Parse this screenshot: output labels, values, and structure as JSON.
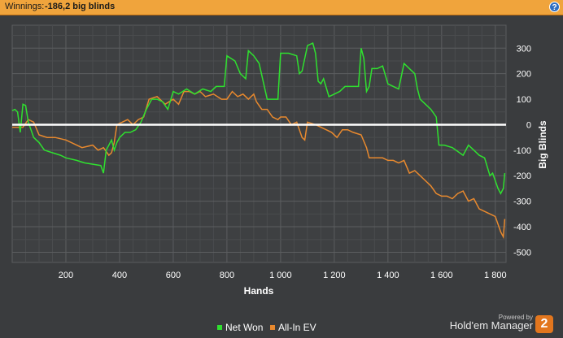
{
  "header": {
    "label": "Winnings:",
    "value": "-186,2 big blinds",
    "help_icon": "?"
  },
  "colors": {
    "net_won": "#2fe02f",
    "all_in_ev": "#e8892e",
    "zero_line": "#ffffff",
    "header_bg": "#f0a43c"
  },
  "chart_data": {
    "type": "line",
    "xlabel": "Hands",
    "ylabel": "Big Blinds",
    "xlim": [
      0,
      1840
    ],
    "ylim": [
      -540,
      390
    ],
    "x_ticks": [
      200,
      400,
      600,
      800,
      1000,
      1200,
      1400,
      1600,
      1800
    ],
    "x_tick_labels": [
      "200",
      "400",
      "600",
      "800",
      "1 000",
      "1 200",
      "1 400",
      "1 600",
      "1 800"
    ],
    "y_ticks": [
      300,
      200,
      100,
      0,
      -100,
      -200,
      -300,
      -400,
      -500
    ],
    "y_tick_labels": [
      "300",
      "200",
      "100",
      "0",
      "-100",
      "-200",
      "-300",
      "-400",
      "-500"
    ],
    "grid": true,
    "legend": "bottom-center",
    "series": [
      {
        "name": "Net Won",
        "points": [
          [
            0,
            55
          ],
          [
            10,
            60
          ],
          [
            20,
            50
          ],
          [
            30,
            -30
          ],
          [
            40,
            80
          ],
          [
            50,
            75
          ],
          [
            60,
            10
          ],
          [
            80,
            -50
          ],
          [
            100,
            -70
          ],
          [
            120,
            -100
          ],
          [
            150,
            -110
          ],
          [
            180,
            -120
          ],
          [
            200,
            -130
          ],
          [
            240,
            -140
          ],
          [
            270,
            -150
          ],
          [
            300,
            -155
          ],
          [
            330,
            -160
          ],
          [
            340,
            -190
          ],
          [
            350,
            -100
          ],
          [
            360,
            -80
          ],
          [
            370,
            -60
          ],
          [
            380,
            -100
          ],
          [
            390,
            -70
          ],
          [
            400,
            -50
          ],
          [
            420,
            -30
          ],
          [
            440,
            -30
          ],
          [
            460,
            -20
          ],
          [
            480,
            10
          ],
          [
            500,
            60
          ],
          [
            520,
            100
          ],
          [
            540,
            100
          ],
          [
            560,
            90
          ],
          [
            580,
            60
          ],
          [
            600,
            130
          ],
          [
            620,
            120
          ],
          [
            650,
            140
          ],
          [
            680,
            120
          ],
          [
            710,
            140
          ],
          [
            740,
            130
          ],
          [
            760,
            150
          ],
          [
            790,
            150
          ],
          [
            800,
            270
          ],
          [
            830,
            250
          ],
          [
            850,
            200
          ],
          [
            870,
            180
          ],
          [
            880,
            290
          ],
          [
            900,
            270
          ],
          [
            920,
            240
          ],
          [
            950,
            100
          ],
          [
            990,
            100
          ],
          [
            1000,
            280
          ],
          [
            1030,
            280
          ],
          [
            1060,
            270
          ],
          [
            1070,
            200
          ],
          [
            1080,
            210
          ],
          [
            1100,
            310
          ],
          [
            1120,
            320
          ],
          [
            1130,
            280
          ],
          [
            1140,
            170
          ],
          [
            1150,
            160
          ],
          [
            1160,
            180
          ],
          [
            1180,
            110
          ],
          [
            1200,
            120
          ],
          [
            1220,
            130
          ],
          [
            1240,
            150
          ],
          [
            1270,
            150
          ],
          [
            1290,
            150
          ],
          [
            1300,
            300
          ],
          [
            1310,
            260
          ],
          [
            1320,
            130
          ],
          [
            1330,
            150
          ],
          [
            1340,
            220
          ],
          [
            1360,
            220
          ],
          [
            1380,
            230
          ],
          [
            1400,
            160
          ],
          [
            1420,
            150
          ],
          [
            1440,
            140
          ],
          [
            1460,
            240
          ],
          [
            1480,
            220
          ],
          [
            1500,
            200
          ],
          [
            1510,
            140
          ],
          [
            1520,
            100
          ],
          [
            1540,
            80
          ],
          [
            1560,
            60
          ],
          [
            1580,
            30
          ],
          [
            1590,
            -80
          ],
          [
            1610,
            -80
          ],
          [
            1640,
            -90
          ],
          [
            1680,
            -120
          ],
          [
            1700,
            -80
          ],
          [
            1720,
            -100
          ],
          [
            1740,
            -120
          ],
          [
            1760,
            -130
          ],
          [
            1780,
            -200
          ],
          [
            1790,
            -190
          ],
          [
            1800,
            -220
          ],
          [
            1810,
            -250
          ],
          [
            1820,
            -270
          ],
          [
            1830,
            -250
          ],
          [
            1835,
            -190
          ]
        ]
      },
      {
        "name": "All-In EV",
        "points": [
          [
            0,
            -10
          ],
          [
            40,
            -10
          ],
          [
            60,
            20
          ],
          [
            80,
            10
          ],
          [
            100,
            -40
          ],
          [
            130,
            -50
          ],
          [
            160,
            -50
          ],
          [
            200,
            -60
          ],
          [
            240,
            -80
          ],
          [
            260,
            -90
          ],
          [
            300,
            -80
          ],
          [
            320,
            -100
          ],
          [
            340,
            -90
          ],
          [
            360,
            -120
          ],
          [
            370,
            -110
          ],
          [
            380,
            -70
          ],
          [
            390,
            0
          ],
          [
            410,
            10
          ],
          [
            430,
            20
          ],
          [
            450,
            0
          ],
          [
            470,
            20
          ],
          [
            490,
            30
          ],
          [
            510,
            100
          ],
          [
            540,
            110
          ],
          [
            570,
            80
          ],
          [
            600,
            100
          ],
          [
            620,
            80
          ],
          [
            640,
            130
          ],
          [
            660,
            130
          ],
          [
            680,
            120
          ],
          [
            700,
            130
          ],
          [
            720,
            110
          ],
          [
            750,
            120
          ],
          [
            780,
            100
          ],
          [
            800,
            100
          ],
          [
            820,
            130
          ],
          [
            840,
            110
          ],
          [
            860,
            120
          ],
          [
            880,
            100
          ],
          [
            900,
            120
          ],
          [
            910,
            90
          ],
          [
            930,
            60
          ],
          [
            950,
            60
          ],
          [
            970,
            30
          ],
          [
            990,
            20
          ],
          [
            1000,
            30
          ],
          [
            1020,
            30
          ],
          [
            1040,
            0
          ],
          [
            1060,
            10
          ],
          [
            1080,
            -50
          ],
          [
            1090,
            -60
          ],
          [
            1100,
            10
          ],
          [
            1130,
            0
          ],
          [
            1150,
            -10
          ],
          [
            1170,
            -20
          ],
          [
            1190,
            -30
          ],
          [
            1210,
            -50
          ],
          [
            1230,
            -20
          ],
          [
            1250,
            -20
          ],
          [
            1270,
            -30
          ],
          [
            1300,
            -40
          ],
          [
            1320,
            -90
          ],
          [
            1330,
            -130
          ],
          [
            1350,
            -130
          ],
          [
            1380,
            -130
          ],
          [
            1400,
            -140
          ],
          [
            1420,
            -140
          ],
          [
            1440,
            -150
          ],
          [
            1460,
            -140
          ],
          [
            1480,
            -190
          ],
          [
            1500,
            -180
          ],
          [
            1520,
            -200
          ],
          [
            1540,
            -220
          ],
          [
            1560,
            -240
          ],
          [
            1580,
            -270
          ],
          [
            1600,
            -280
          ],
          [
            1620,
            -280
          ],
          [
            1640,
            -290
          ],
          [
            1660,
            -270
          ],
          [
            1680,
            -260
          ],
          [
            1700,
            -300
          ],
          [
            1720,
            -290
          ],
          [
            1740,
            -330
          ],
          [
            1760,
            -340
          ],
          [
            1780,
            -350
          ],
          [
            1800,
            -360
          ],
          [
            1810,
            -390
          ],
          [
            1820,
            -420
          ],
          [
            1830,
            -440
          ],
          [
            1835,
            -370
          ]
        ]
      }
    ]
  },
  "branding": {
    "powered_by": "Powered by",
    "product": "Hold'em Manager",
    "version": "2"
  }
}
